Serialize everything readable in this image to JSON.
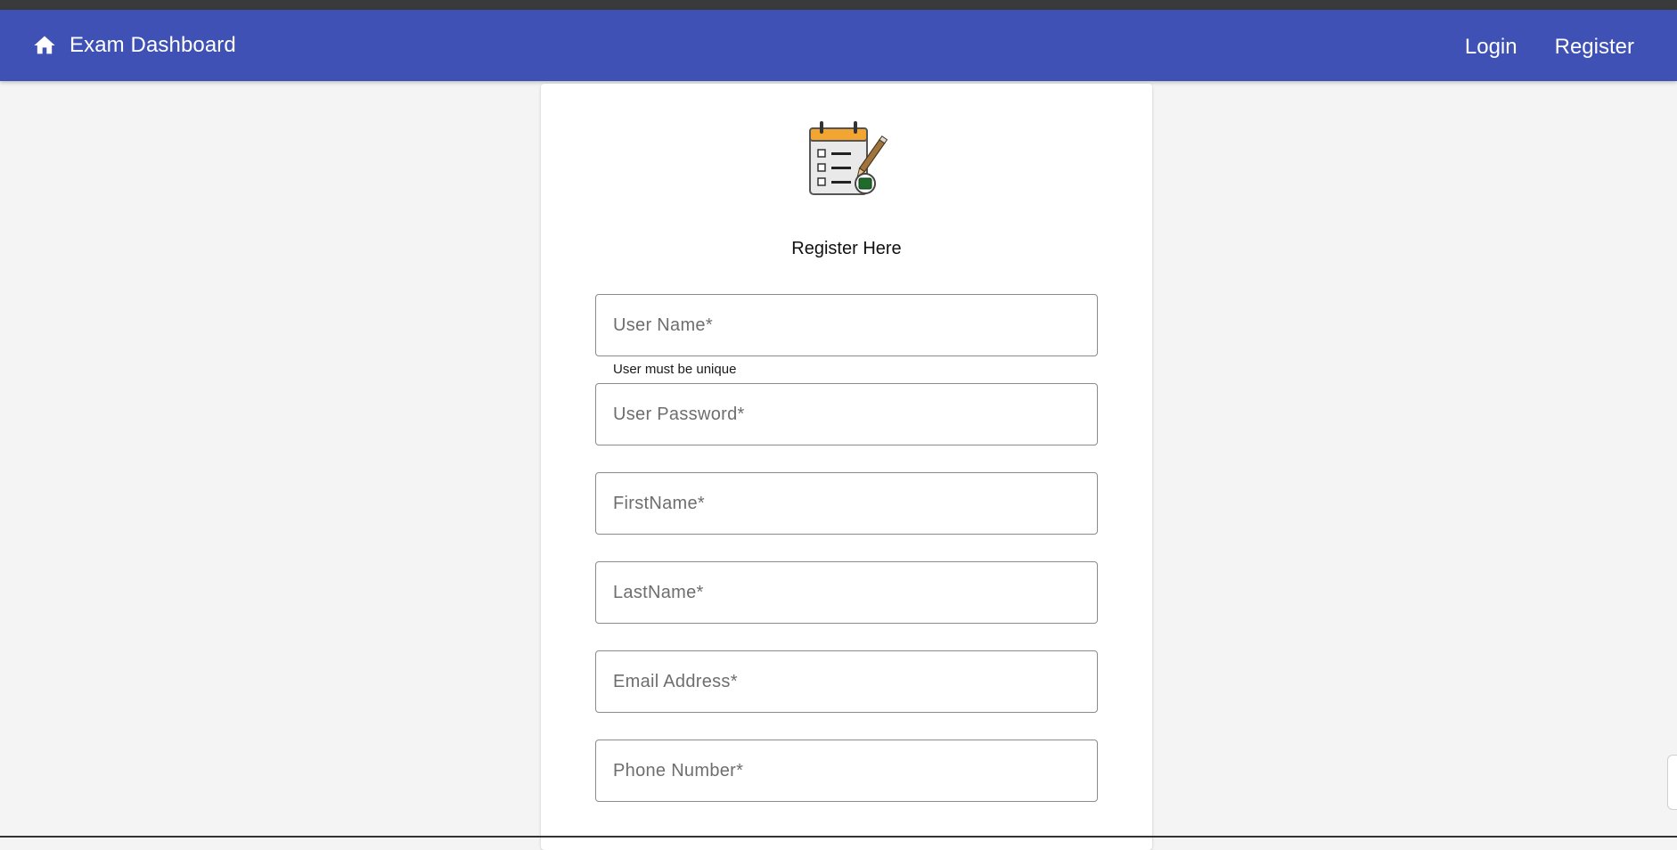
{
  "navbar": {
    "brand_icon": "home-icon",
    "title": "Exam Dashboard",
    "links": [
      {
        "label": "Login"
      },
      {
        "label": "Register"
      }
    ],
    "color": "#3f51b5"
  },
  "form": {
    "logo_icon": "exam-checklist-icon",
    "heading": "Register Here",
    "fields": [
      {
        "placeholder": "User Name*",
        "value": ""
      },
      {
        "placeholder": "User Password*",
        "value": ""
      },
      {
        "placeholder": "FirstName*",
        "value": ""
      },
      {
        "placeholder": "LastName*",
        "value": ""
      },
      {
        "placeholder": "Email Address*",
        "value": ""
      },
      {
        "placeholder": "Phone Number*",
        "value": ""
      }
    ],
    "username_hint": "User must be unique"
  }
}
